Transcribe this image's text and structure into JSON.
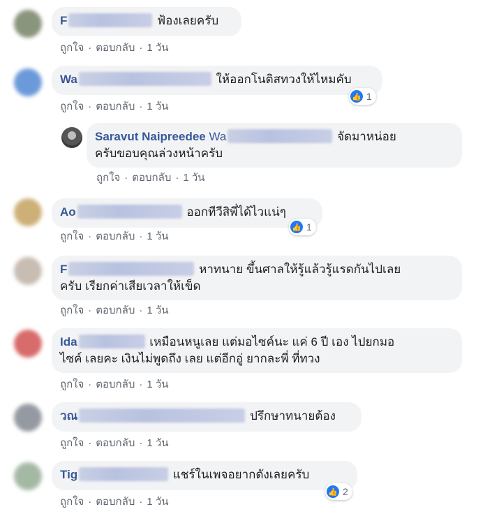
{
  "actions": {
    "like": "ถูกใจ",
    "reply": "ตอบกลับ",
    "time": "1 วัน",
    "sep": "·"
  },
  "comments": [
    {
      "name": "F",
      "text": "ฟ้องเลยครับ",
      "reactions": ""
    },
    {
      "name": "Wa",
      "text": "ให้ออกโนติสทวงให้ไหมคับ",
      "reactions": "1"
    },
    {
      "name": "Saravut Naipreedee",
      "tag": "Wa",
      "text1": "จัดมาหน่อย",
      "text2": "ครับขอบคุณล่วงหน้าครับ",
      "reactions": ""
    },
    {
      "name": "Ao",
      "text": "ออกทีวีสิพี่ได้ไวแน่ๆ",
      "reactions": "1"
    },
    {
      "name": "F",
      "text1": "หาทนาย ขึ้นศาลให้รู้แล้วรู้แรดกันไปเลย",
      "text2": "ครับ เรียกค่าเสียเวลาให้เข็ด",
      "reactions": ""
    },
    {
      "name": "Ida",
      "text1": "เหมือนหนูเลย แต่มอไซค์นะ แค่ 6 ปี เอง ไปยกมอ",
      "text2": "ไซค์ เลยคะ เงินไม่พูดถึง เลย แต่อีกอู่ ยากละพี่ ที่ทวง",
      "reactions": ""
    },
    {
      "name": "วณ",
      "text": "ปรึกษาทนายต้อง",
      "reactions": ""
    },
    {
      "name": "Tig",
      "text": "แชร์ในเพจอยากดังเลยครับ",
      "reactions": "2"
    }
  ],
  "colors": {
    "name": "#385898",
    "bubble": "#f2f3f5",
    "like": "#2078f4"
  }
}
